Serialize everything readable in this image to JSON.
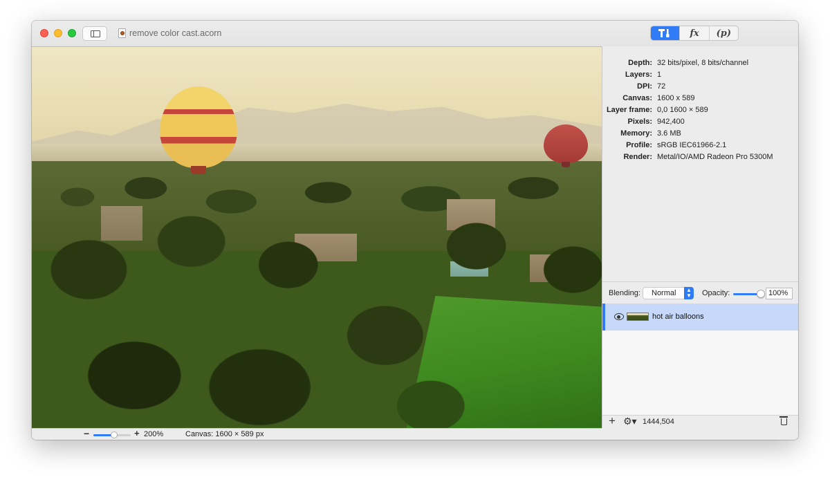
{
  "window": {
    "document_title": "remove color cast.acorn"
  },
  "toolbar": {
    "segments": [
      {
        "label": "",
        "icon": "tools-icon",
        "active": true
      },
      {
        "label": "fx",
        "icon": "fx-icon",
        "active": false
      },
      {
        "label": "(p)",
        "icon": "p-icon",
        "active": false
      }
    ]
  },
  "info": {
    "rows": [
      {
        "key": "Depth:",
        "value": "32 bits/pixel, 8 bits/channel"
      },
      {
        "key": "Layers:",
        "value": "1"
      },
      {
        "key": "DPI:",
        "value": "72"
      },
      {
        "key": "Canvas:",
        "value": "1600 x 589"
      },
      {
        "key": "Layer frame:",
        "value": "0,0 1600 × 589"
      },
      {
        "key": "Pixels:",
        "value": "942,400"
      },
      {
        "key": "Memory:",
        "value": "3.6 MB"
      },
      {
        "key": "Profile:",
        "value": "sRGB IEC61966-2.1"
      },
      {
        "key": "Render:",
        "value": "Metal/IO/AMD Radeon Pro 5300M"
      }
    ]
  },
  "blending": {
    "label": "Blending:",
    "mode": "Normal",
    "opacity_label": "Opacity:",
    "opacity_value": "100%",
    "opacity_fraction": 1.0
  },
  "layers": [
    {
      "name": "hot air balloons",
      "visible": true,
      "selected": true
    }
  ],
  "sidebar_footer": {
    "coordinates": "1444,504"
  },
  "statusbar": {
    "zoom_minus": "−",
    "zoom_plus": "+",
    "zoom_label": "200%",
    "zoom_fraction": 0.55,
    "canvas_size": "Canvas: 1600 × 589 px"
  },
  "colors": {
    "accent": "#2f7cf6",
    "selection": "#c7d9fb"
  }
}
